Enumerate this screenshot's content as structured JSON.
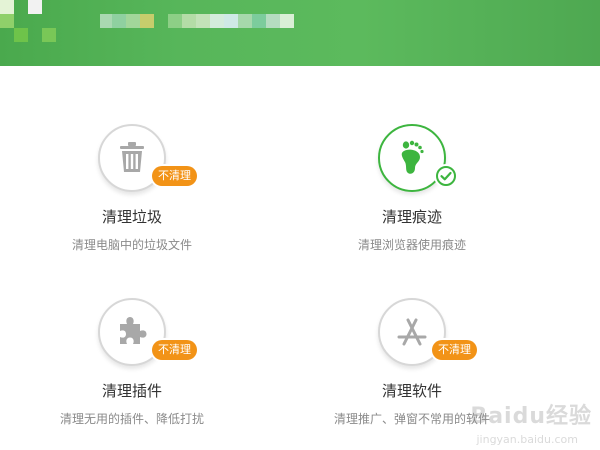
{
  "colors": {
    "header_green": "#55b458",
    "accent_green": "#3db53f",
    "badge_orange": "#f29317",
    "icon_gray": "#b0b0b0",
    "desc_gray": "#8a8a8a"
  },
  "options": [
    {
      "title": "清理垃圾",
      "description": "清理电脑中的垃圾文件",
      "icon": "trash-icon",
      "status": "不清理",
      "selected": false
    },
    {
      "title": "清理痕迹",
      "description": "清理浏览器使用痕迹",
      "icon": "footprint-icon",
      "status": "",
      "selected": true
    },
    {
      "title": "清理插件",
      "description": "清理无用的插件、降低打扰",
      "icon": "puzzle-icon",
      "status": "不清理",
      "selected": false
    },
    {
      "title": "清理软件",
      "description": "清理推广、弹窗不常用的软件",
      "icon": "app-store-icon",
      "status": "不清理",
      "selected": false
    }
  ],
  "watermark": {
    "text": "Baidu经验",
    "url": "jingyan.baidu.com"
  }
}
